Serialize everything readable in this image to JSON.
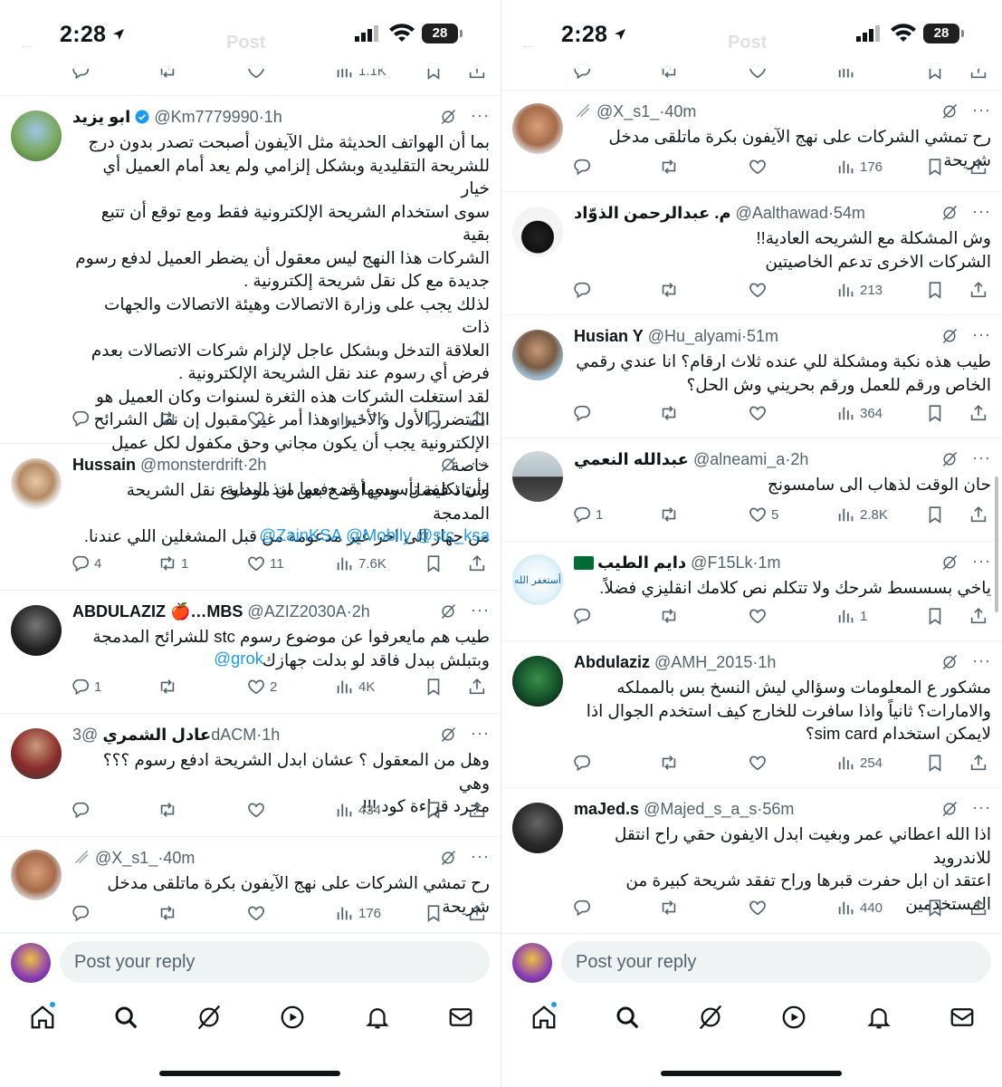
{
  "status": {
    "time": "2:28",
    "battery": "28",
    "ghost_title": "Post"
  },
  "reply_placeholder": "Post your reply",
  "colors": {
    "accent": "#1d9bf0",
    "text": "#0f1419",
    "muted": "#536471"
  },
  "left": {
    "partial_views": "1.1K",
    "tweets": [
      {
        "name": "ابو يزيد",
        "handle": "@Km7779990",
        "time": "1h",
        "verified": true,
        "body": "بما أن الهواتف الحديثة مثل الآيفون أصبحت تصدر بدون درج\nللشريحة التقليدية وبشكل إلزامي ولم يعد أمام العميل أي خيار\nسوى استخدام الشريحة الإلكترونية فقط ومع توقع أن تتبع بقية\nالشركات هذا النهج ليس معقول أن يضطر العميل لدفع رسوم\nجديدة مع كل نقل شريحة إلكترونية .\nلذلك يجب على وزارة الاتصالات وهيئة الاتصالات والجهات ذات\nالعلاقة التدخل وبشكل عاجل لإلزام شركات الاتصالات بعدم\nفرض أي رسوم عند نقل الشريحة الإلكترونية .\nلقد استغلت الشركات هذه الثغرة لسنوات وكان العميل هو\nالمتضرر الأول والأخير وهذا أمر غير مقبول إن نقل الشرائح\nالإلكترونية يجب أن يكون مجاني وحق مكفول لكل عميل خاصة\nوأن تكلفة تأسيسها قد دفعها منذ البداية.",
        "mentions": "",
        "replies": "",
        "reposts": "",
        "likes": "",
        "views": "1.7K"
      },
      {
        "name": "Hussain",
        "handle": "@monsterdrift",
        "time": "2h",
        "verified": false,
        "body": "استاذ فيصل، ودي أوضح بس ان موضوع نقل الشريحة المدمجة\nمن جهاز الى اخر غير مدعومة من قبل المشغلين اللي عندنا.",
        "mentions": "@ZainKSA @Mobily @stc_ksa",
        "replies": "4",
        "reposts": "1",
        "likes": "11",
        "views": "7.6K"
      },
      {
        "name": "ABDULAZIZ 🍎…MBS",
        "handle": "@AZIZ2030A",
        "time": "2h",
        "verified": false,
        "body": "طيب هم مايعرفوا عن موضوع رسوم stc للشرائح المدمجة\nوبتبلش ببدل فاقد لو بدلت جهازك",
        "mentions": "@grok",
        "replies": "1",
        "reposts": "",
        "likes": "2",
        "views": "4K"
      },
      {
        "name": "عادل الشمري",
        "handle": "@3dACM",
        "time": "1h",
        "verified": false,
        "body": "وهل من المعقول ؟ عشان ابدل الشريحة ادفع رسوم ؟؟؟ وهي\nمجرد قراءة كود !!!",
        "mentions": "",
        "replies": "",
        "reposts": "",
        "likes": "",
        "views": "434"
      },
      {
        "name": "",
        "handle": "@X_s1_",
        "time": "40m",
        "verified": false,
        "body": "رح تمشي الشركات على نهج الآيفون بكرة ماتلقى مدخل شريحة",
        "mentions": "",
        "replies": "",
        "reposts": "",
        "likes": "",
        "views": "176"
      }
    ]
  },
  "right": {
    "tweets": [
      {
        "name": "",
        "handle": "@X_s1_",
        "time": "40m",
        "verified": false,
        "body": "رح تمشي الشركات على نهج الآيفون بكرة ماتلقى مدخل شريحة",
        "replies": "",
        "reposts": "",
        "likes": "",
        "views": "176"
      },
      {
        "name": "م. عبدالرحمن الذوّاد",
        "handle": "@Aalthawad",
        "time": "54m",
        "verified": false,
        "body": "وش المشكلة مع الشريحه العادية!!\nالشركات الاخرى تدعم الخاصيتين",
        "replies": "",
        "reposts": "",
        "likes": "",
        "views": "213"
      },
      {
        "name": "Husian Y",
        "handle": "@Hu_alyami",
        "time": "51m",
        "verified": false,
        "body": "طيب هذه نكبة ومشكلة للي عنده ثلاث ارقام؟ انا عندي رقمي\nالخاص ورقم للعمل ورقم بحريني وش الحل؟",
        "replies": "",
        "reposts": "",
        "likes": "",
        "views": "364"
      },
      {
        "name": "عبدالله النعمي",
        "handle": "@alneami_a",
        "time": "2h",
        "verified": false,
        "body": "حان الوقت لذهاب الى سامسونج",
        "replies": "1",
        "reposts": "",
        "likes": "5",
        "views": "2.8K"
      },
      {
        "name": "دايم الطيب",
        "handle": "@F15Lk",
        "time": "1m",
        "verified": false,
        "body": "ياخي بسسسط شرحك ولا تتكلم نص كلامك انقليزي فضلاً.",
        "replies": "",
        "reposts": "",
        "likes": "",
        "views": "1"
      },
      {
        "name": "Abdulaziz",
        "handle": "@AMH_2015",
        "time": "1h",
        "verified": false,
        "body": "مشكور ع المعلومات وسؤالي ليش النسخ  بس بالمملكه\nوالامارات؟ ثانياً واذا سافرت للخارج كيف استخدم الجوال اذا\nلايمكن استخدام  sim card؟",
        "replies": "",
        "reposts": "",
        "likes": "",
        "views": "254"
      },
      {
        "name": "maJed.s",
        "handle": "@Majed_s_a_s",
        "time": "56m",
        "verified": false,
        "body": "اذا الله اعطاني عمر وبغيت ابدل الايفون حقي راح انتقل للاندرويد\nاعتقد ان ابل حفرت قبرها وراح تفقد شريحة كبيرة من\nالمستخدمين",
        "replies": "",
        "reposts": "",
        "likes": "",
        "views": "440"
      }
    ]
  },
  "avatar_text": {
    "f15lk": "أستغفر الله"
  },
  "nav": [
    "home-icon",
    "search-icon",
    "grok-icon",
    "video-icon",
    "bell-icon",
    "mail-icon"
  ]
}
